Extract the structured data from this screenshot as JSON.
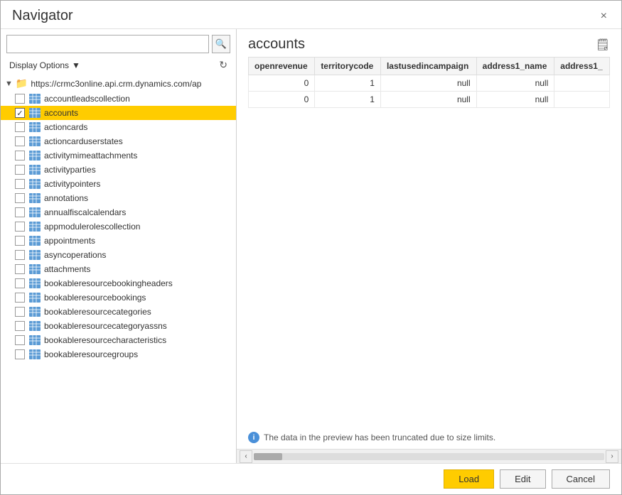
{
  "dialog": {
    "title": "Navigator",
    "close_label": "×"
  },
  "left_panel": {
    "search_placeholder": "",
    "display_options_label": "Display Options",
    "display_options_arrow": "▼",
    "root_node": {
      "arrow": "▼",
      "url": "https://crmc3online.api.crm.dynamics.com/ap"
    },
    "items": [
      {
        "label": "accountleadscollection",
        "checked": false,
        "selected": false
      },
      {
        "label": "accounts",
        "checked": true,
        "selected": true
      },
      {
        "label": "actioncards",
        "checked": false,
        "selected": false
      },
      {
        "label": "actioncarduserstates",
        "checked": false,
        "selected": false
      },
      {
        "label": "activitymimeattachments",
        "checked": false,
        "selected": false
      },
      {
        "label": "activityparties",
        "checked": false,
        "selected": false
      },
      {
        "label": "activitypointers",
        "checked": false,
        "selected": false
      },
      {
        "label": "annotations",
        "checked": false,
        "selected": false
      },
      {
        "label": "annualfiscalcalendars",
        "checked": false,
        "selected": false
      },
      {
        "label": "appmodulerolescollection",
        "checked": false,
        "selected": false
      },
      {
        "label": "appointments",
        "checked": false,
        "selected": false
      },
      {
        "label": "asyncoperations",
        "checked": false,
        "selected": false
      },
      {
        "label": "attachments",
        "checked": false,
        "selected": false
      },
      {
        "label": "bookableresourcebookingheaders",
        "checked": false,
        "selected": false
      },
      {
        "label": "bookableresourcebookings",
        "checked": false,
        "selected": false
      },
      {
        "label": "bookableresourcecategories",
        "checked": false,
        "selected": false
      },
      {
        "label": "bookableresourcecategoryassns",
        "checked": false,
        "selected": false
      },
      {
        "label": "bookableresourcecharacteristics",
        "checked": false,
        "selected": false
      },
      {
        "label": "bookableresourcegroups",
        "checked": false,
        "selected": false
      }
    ]
  },
  "right_panel": {
    "title": "accounts",
    "table": {
      "columns": [
        "openrevenue",
        "territorycode",
        "lastusedincampaign",
        "address1_name",
        "address1_"
      ],
      "rows": [
        [
          "0",
          "1",
          "null",
          "null",
          ""
        ],
        [
          "0",
          "1",
          "null",
          "null",
          ""
        ]
      ]
    },
    "info_message": "The data in the preview has been truncated due to size limits."
  },
  "footer": {
    "load_label": "Load",
    "edit_label": "Edit",
    "cancel_label": "Cancel"
  },
  "icons": {
    "search": "🔍",
    "refresh": "↻",
    "export": "📋",
    "info": "i",
    "chevron_left": "‹",
    "chevron_right": "›",
    "check": "✓"
  }
}
